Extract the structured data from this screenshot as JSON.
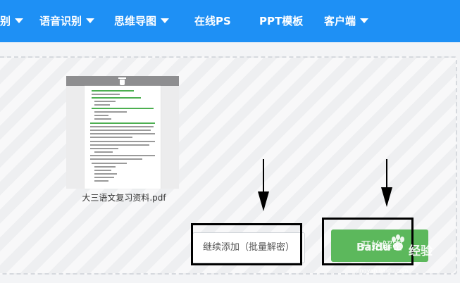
{
  "nav": {
    "items": [
      {
        "label": "别",
        "has_caret": true
      },
      {
        "label": "语音识别",
        "has_caret": true
      },
      {
        "label": "思维导图",
        "has_caret": true
      },
      {
        "label": "在线PS",
        "has_caret": false
      },
      {
        "label": "PPT模板",
        "has_caret": false
      },
      {
        "label": "客户端",
        "has_caret": true
      }
    ]
  },
  "upload": {
    "file": {
      "name": "大三语文复习资料.pdf",
      "icon": "pdf-document-thumbnail"
    },
    "add_more_label": "继续添加（批量解密）",
    "start_label": "开始解密"
  },
  "watermark": {
    "brand": "Baidu",
    "text": "经验",
    "url": "jingyan.baidu.com"
  },
  "colors": {
    "nav_bg": "#1e90f5",
    "start_btn": "#5cb85c",
    "annotation": "#000000"
  }
}
